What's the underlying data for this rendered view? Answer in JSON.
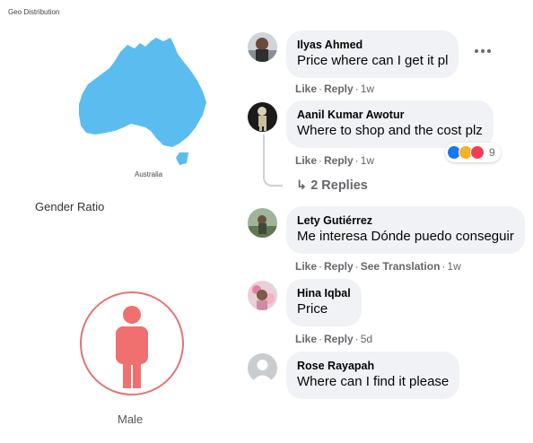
{
  "analytics": {
    "geo_title": "Geo Distribution",
    "map_caption": "Australia",
    "map_color": "#5bbcf0",
    "gender_title": "Gender Ratio",
    "gender_label": "Male",
    "gender_color": "#f07070"
  },
  "comments": [
    {
      "author": "Ilyas Ahmed",
      "text": "Price where can I get it pl",
      "actions": [
        "Like",
        "Reply"
      ],
      "time": "1w"
    },
    {
      "author": "Aanil Kumar Awotur",
      "text": "Where to shop and the cost plz",
      "actions": [
        "Like",
        "Reply"
      ],
      "time": "1w",
      "reaction_count": "9",
      "replies_label": "2 Replies"
    },
    {
      "author": "Lety Gutiérrez",
      "text": "Me interesa Dónde puedo conseguir",
      "actions": [
        "Like",
        "Reply",
        "See Translation"
      ],
      "time": "1w"
    },
    {
      "author": "Hina Iqbal",
      "text": "Price",
      "actions": [
        "Like",
        "Reply"
      ],
      "time": "5d"
    },
    {
      "author": "Rose Rayapah",
      "text": "Where can I find it please"
    }
  ],
  "icons": {
    "reply_arrow": "↳",
    "reactions": [
      "like-icon",
      "haha-icon",
      "love-icon"
    ]
  }
}
